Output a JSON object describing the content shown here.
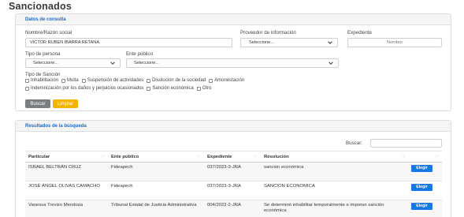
{
  "page": {
    "title": "Sancionados"
  },
  "consulta": {
    "header": "Datos de consulta",
    "nombre": {
      "label": "Nombre/Razón social",
      "value": "VICTOR RUBEN IBARRA RETANA"
    },
    "proveedor": {
      "label": "Proveedor de información",
      "value": "Seleccione..."
    },
    "expediente": {
      "label": "Expediente",
      "placeholder": "Nombre"
    },
    "tipo_persona": {
      "label": "Tipo de persona",
      "value": "Seleccione..."
    },
    "ente": {
      "label": "Ente público",
      "value": "Seleccione..."
    },
    "tipo_sancion": {
      "label": "Tipo de Sanción",
      "row1": [
        "Inhabilitación",
        "Multa",
        "Suspensión de actividades",
        "Disolución de la sociedad",
        "Amonestación"
      ],
      "row2": [
        "Indemnización por los daños y perjuicios ocasionados",
        "Sanción económica",
        "Otro"
      ]
    },
    "buttons": {
      "search": "Buscar",
      "clear": "Limpiar"
    }
  },
  "resultados": {
    "header": "Resultados de la búsqueda",
    "search_label": "Buscar:",
    "columns": [
      "Particular",
      "Ente público",
      "Expediente",
      "Resolución",
      ""
    ],
    "sort_glyph": "↑↓",
    "rows": [
      {
        "particular": "ISRAEL BELTRÁN CRUZ",
        "ente": "Fideapech",
        "expediente": "037/2023-3-JRA",
        "resolucion": "sancion económica",
        "action": "Elegir"
      },
      {
        "particular": "JOSÉ ÁNGEL OLIVAS CAMACHO",
        "ente": "Fideapech",
        "expediente": "037/2023-3-JRA",
        "resolucion": "SANCION ECONOMICA",
        "action": "Elegir"
      },
      {
        "particular": "Vanessa Trevizo Mendoza",
        "ente": "Tribunal Estatal de Justicia Administrativa",
        "expediente": "004/2022-2-JRA",
        "resolucion": "Se determinó inhabilitar temporalmente e imponer sanción económica",
        "action": "Elegir"
      }
    ]
  },
  "colors": {
    "accent": "#1a6cc8",
    "button_primary": "#1877e6",
    "button_search": "#7b7e80",
    "button_clear": "#f4b400"
  },
  "icons": {
    "select": "chevron-down-icon"
  }
}
